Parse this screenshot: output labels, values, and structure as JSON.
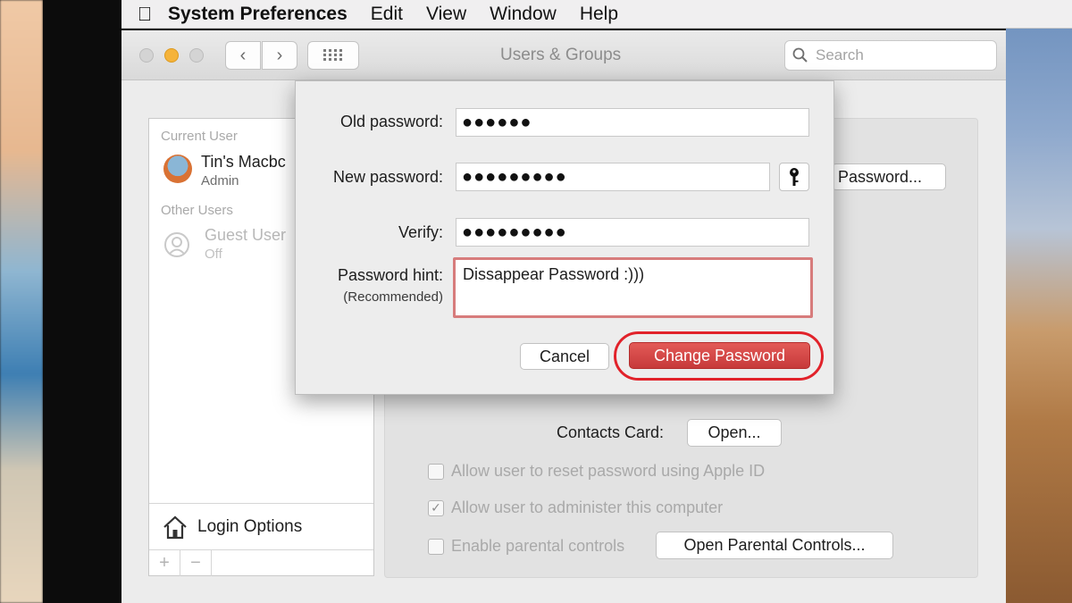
{
  "menubar": {
    "app_name": "System Preferences",
    "items": [
      "Edit",
      "View",
      "Window",
      "Help"
    ]
  },
  "window": {
    "title": "Users & Groups",
    "search_placeholder": "Search"
  },
  "sidebar": {
    "current_user_header": "Current User",
    "current_user_name": "Tin's Macbc",
    "current_user_role": "Admin",
    "other_users_header": "Other Users",
    "guest_name": "Guest User",
    "guest_status": "Off",
    "login_options": "Login Options",
    "add": "+",
    "remove": "−"
  },
  "main": {
    "password_button": "Password...",
    "contacts_card_label": "Contacts Card:",
    "contacts_open_button": "Open...",
    "options": [
      {
        "label": "Allow user to reset password using Apple ID",
        "checked": false
      },
      {
        "label": "Allow user to administer this computer",
        "checked": true
      },
      {
        "label": "Enable parental controls",
        "checked": false
      }
    ],
    "parental_controls_button": "Open Parental Controls..."
  },
  "dialog": {
    "old_password_label": "Old password:",
    "old_password_value": "●●●●●●",
    "new_password_label": "New password:",
    "new_password_value": "●●●●●●●●●",
    "verify_label": "Verify:",
    "verify_value": "●●●●●●●●●",
    "hint_label": "Password hint:",
    "hint_sublabel": "(Recommended)",
    "hint_value": "Dissappear Password :)))",
    "cancel_button": "Cancel",
    "change_button": "Change Password"
  },
  "colors": {
    "accent_red": "#d44a48",
    "highlight_ring": "#e1222a",
    "hint_border": "#d77c7c"
  }
}
